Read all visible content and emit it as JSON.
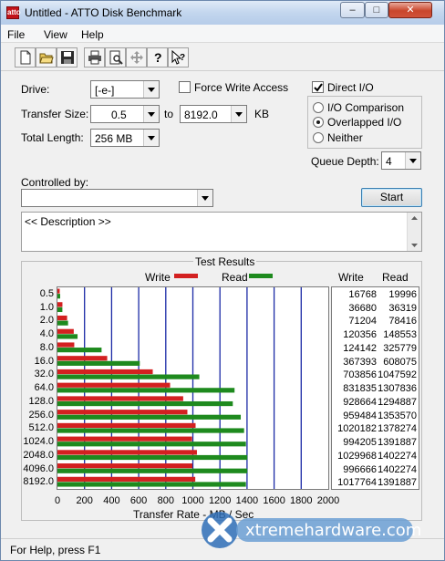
{
  "window": {
    "title": "Untitled - ATTO Disk Benchmark",
    "app_icon_text": "atto"
  },
  "title_controls": {
    "minimize": "–",
    "maximize": "□",
    "close": "✕"
  },
  "menu": [
    "File",
    "View",
    "Help"
  ],
  "toolbar": {
    "icons": [
      "new-file-icon",
      "open-folder-icon",
      "save-icon",
      "print-icon",
      "print-preview-icon",
      "move-icon",
      "help-icon",
      "context-help-icon"
    ]
  },
  "form": {
    "drive_label": "Drive:",
    "drive_value": "[-e-]",
    "force_write_label": "Force Write Access",
    "force_write_checked": false,
    "direct_io_label": "Direct I/O",
    "direct_io_checked": true,
    "transfer_size_label": "Transfer Size:",
    "transfer_from": "0.5",
    "to_label": "to",
    "transfer_to": "8192.0",
    "unit_label": "KB",
    "total_length_label": "Total Length:",
    "total_length_value": "256 MB",
    "io_options": [
      "I/O Comparison",
      "Overlapped I/O",
      "Neither"
    ],
    "io_selected": "Overlapped I/O",
    "queue_depth_label": "Queue Depth:",
    "queue_depth_value": "4",
    "controlled_by_label": "Controlled by:",
    "controlled_by_value": "",
    "start_label": "Start",
    "description_text": "<< Description >>"
  },
  "results": {
    "title": "Test Results",
    "legend_write": "Write",
    "legend_read": "Read",
    "col_write": "Write",
    "col_read": "Read",
    "write_color": "#d32020",
    "read_color": "#1e8a1e"
  },
  "chart_data": {
    "type": "bar",
    "orientation": "horizontal",
    "categories": [
      "0.5",
      "1.0",
      "2.0",
      "4.0",
      "8.0",
      "16.0",
      "32.0",
      "64.0",
      "128.0",
      "256.0",
      "512.0",
      "1024.0",
      "2048.0",
      "4096.0",
      "8192.0"
    ],
    "series": [
      {
        "name": "Write",
        "values": [
          16768,
          36680,
          71204,
          120356,
          124142,
          367393,
          703856,
          831835,
          928664,
          959484,
          1020182,
          994205,
          1029968,
          996666,
          1017764
        ]
      },
      {
        "name": "Read",
        "values": [
          19996,
          36319,
          78416,
          148553,
          325779,
          608075,
          1047592,
          1307836,
          1294887,
          1353570,
          1378274,
          1391887,
          1402274,
          1402274,
          1391887
        ]
      }
    ],
    "xlabel": "Transfer Rate - MB / Sec",
    "x_ticks": [
      "0",
      "200",
      "400",
      "600",
      "800",
      "1000",
      "1200",
      "1400",
      "1600",
      "1800",
      "2000"
    ],
    "xlim": [
      0,
      2000
    ],
    "value_unit_divisor": 1000,
    "grid": true,
    "legend": "top"
  },
  "status": {
    "text": "For Help, press F1"
  },
  "watermark": {
    "text": "xtremehardware.com"
  }
}
